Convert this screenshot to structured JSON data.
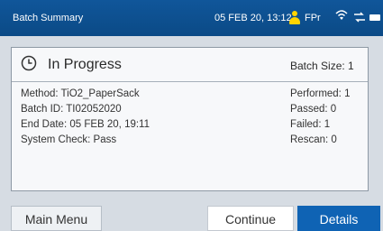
{
  "statusbar": {
    "title": "Batch Summary",
    "datetime": "05 FEB 20, 13:12",
    "user": "FPr",
    "icons": [
      "user-icon",
      "wifi-icon",
      "network-icon",
      "battery-icon"
    ]
  },
  "card": {
    "icon": "clock-icon",
    "title": "In Progress",
    "batch_size": "Batch Size: 1",
    "left": [
      "Method: TiO2_PaperSack",
      "Batch ID: TI02052020",
      "End Date: 05 FEB 20, 19:11",
      "System Check: Pass"
    ],
    "right": [
      "Performed: 1",
      "Passed: 0",
      "Failed: 1",
      "Rescan: 0"
    ]
  },
  "buttons": {
    "main_menu": "Main Menu",
    "continue": "Continue",
    "details": "Details"
  },
  "colors": {
    "statusbar": "#0b4a86",
    "accent": "#0f63b4",
    "user_icon": "#ffd400",
    "background": "#d6dce3"
  }
}
